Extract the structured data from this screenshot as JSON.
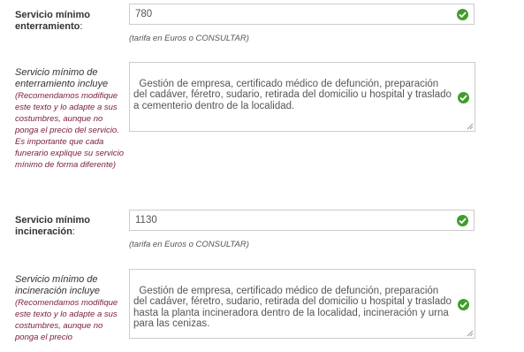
{
  "field1": {
    "label_line1": "Servicio mínimo",
    "label_line2": "enterramiento",
    "label_colon": ":",
    "value": "780",
    "hint": "(tarifa en Euros o CONSULTAR)"
  },
  "field2": {
    "label_line1": "Servicio mínimo de",
    "label_line2": "enterramiento incluye",
    "note": "(Recomendamos modifique este texto y lo adapte a sus costumbres, aunque no ponga el precio del servicio. Es importante que cada funerario explique su servicio mínimo de forma diferente)",
    "value": "Gestión de empresa, certificado médico de defunción, preparación del cadáver, féretro, sudario, retirada del domicilio u hospital y traslado a cementerio dentro de la localidad."
  },
  "field3": {
    "label_line1": "Servicio mínimo",
    "label_line2": "incineración",
    "label_colon": ":",
    "value": "1130",
    "hint": "(tarifa en Euros o CONSULTAR)"
  },
  "field4": {
    "label_line1": "Servicio mínimo de",
    "label_line2": "incineración incluye",
    "note": "(Recomendamos modifique este texto y lo adapte a sus costumbres, aunque no ponga el precio",
    "value": "Gestión de empresa, certificado médico de defunción, preparación del cadáver, féretro, sudario, retirada del domicilio u hospital y traslado hasta la planta incineradora dentro de la localidad, incineración y urna para las cenizas."
  },
  "icons": {
    "valid": "check-circle-icon",
    "resize": "resize-grip-icon"
  },
  "colors": {
    "valid": "#3f9e2b",
    "note": "#7a1c3b",
    "border": "#cccccc"
  }
}
